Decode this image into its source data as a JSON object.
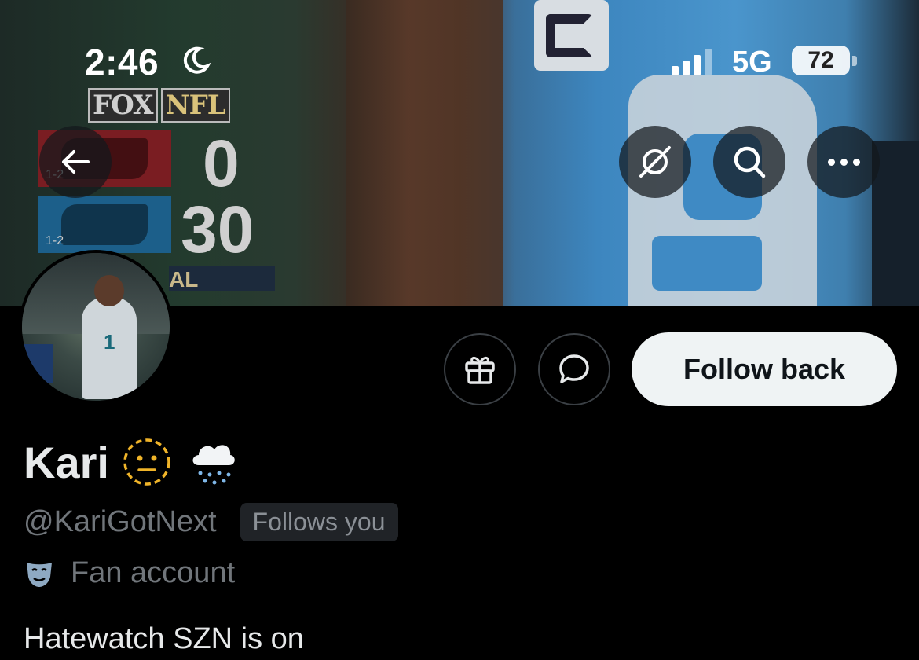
{
  "status_bar": {
    "time": "2:46",
    "network": "5G",
    "battery": "72"
  },
  "banner": {
    "broadcast_logo_left": "FOX",
    "broadcast_logo_right": "NFL",
    "scoreboard": [
      {
        "record": "1-2",
        "score": "0"
      },
      {
        "record": "1-2",
        "score": "30"
      }
    ],
    "final_fragment": "AL"
  },
  "profile": {
    "display_name": "Kari",
    "handle": "@KariGotNext",
    "follows_you": "Follows you",
    "category": "Fan account",
    "bio": "Hatewatch SZN is on",
    "follow_button": "Follow back"
  },
  "icons": {
    "back": "arrow-left-icon",
    "grok": "grok-icon",
    "search": "search-icon",
    "more": "more-icon",
    "gift": "gift-icon",
    "message": "message-icon",
    "category": "mask-icon"
  },
  "colors": {
    "background": "#000000",
    "follow_button_bg": "#eff3f4",
    "muted_text": "#71767b"
  }
}
